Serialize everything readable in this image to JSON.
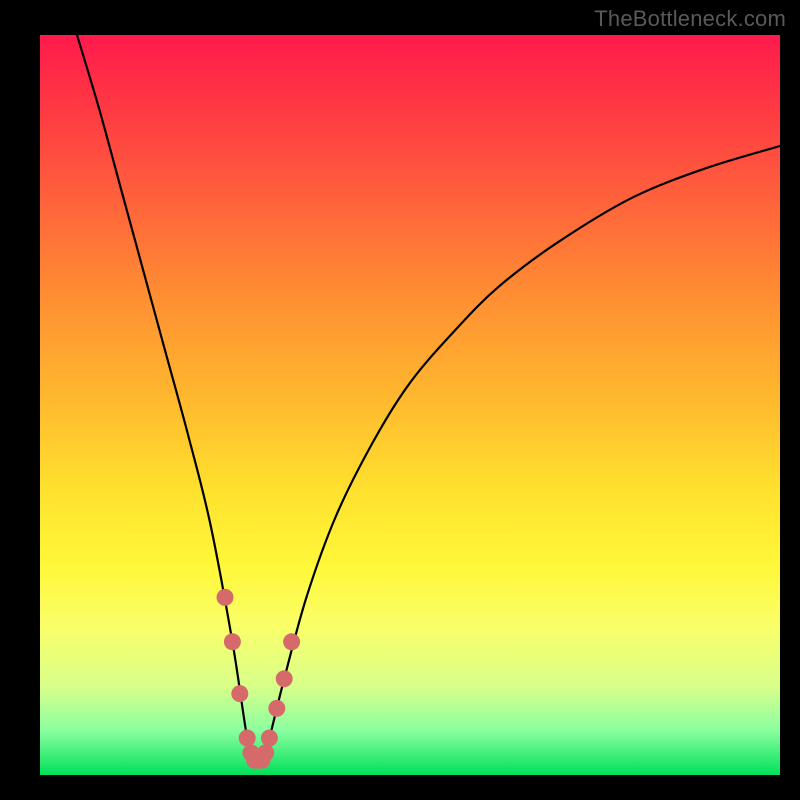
{
  "attribution": "TheBottleneck.com",
  "colors": {
    "frame": "#000000",
    "curve_stroke": "#000000",
    "marker_stroke": "#d66a6a",
    "gradient_top": "#ff1a4d",
    "gradient_bottom": "#00e05a"
  },
  "chart_data": {
    "type": "line",
    "title": "",
    "xlabel": "",
    "ylabel": "",
    "xlim": [
      0,
      100
    ],
    "ylim": [
      0,
      100
    ],
    "grid": false,
    "bottleneck_x": 29,
    "series": [
      {
        "name": "bottleneck-curve",
        "x": [
          5,
          8,
          11,
          14,
          17,
          20,
          23,
          26,
          28,
          29,
          30,
          31,
          33,
          36,
          40,
          45,
          50,
          56,
          62,
          70,
          80,
          90,
          100
        ],
        "values": [
          100,
          90,
          79,
          68,
          57,
          46,
          34,
          18,
          5,
          2,
          2,
          5,
          13,
          24,
          35,
          45,
          53,
          60,
          66,
          72,
          78,
          82,
          85
        ]
      }
    ],
    "markers": {
      "name": "highlight-dots",
      "x": [
        25,
        26,
        27,
        28,
        28.5,
        29,
        29.5,
        30,
        30.5,
        31,
        32,
        33,
        34
      ],
      "values": [
        24,
        18,
        11,
        5,
        3,
        2,
        2,
        2,
        3,
        5,
        9,
        13,
        18
      ]
    }
  }
}
